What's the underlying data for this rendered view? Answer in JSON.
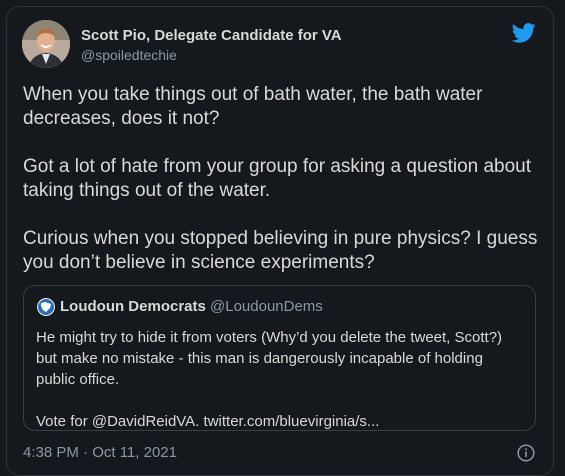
{
  "author": {
    "name": "Scott Pio, Delegate Candidate for VA",
    "handle": "@spoiledtechie"
  },
  "tweet": {
    "paragraphs": [
      "When you take things out of bath water, the bath water decreases, does it not?",
      "Got a lot of hate from your group for asking a question about taking things out of the water.",
      "Curious when you stopped believing in pure physics? I guess you don’t believe in science experiments?"
    ]
  },
  "quoted": {
    "name": "Loudoun Democrats",
    "handle": "@LoudounDems",
    "paragraphs": [
      "He might try to hide it from voters (Why’d you delete the tweet, Scott?) but make no mistake - this man is dangerously incapable of holding public office.",
      "Vote for @DavidReidVA. twitter.com/bluevirginia/s..."
    ]
  },
  "footer": {
    "timestamp": "4:38 PM · Oct 11, 2021"
  },
  "icons": {
    "brand": "twitter-bird-icon",
    "info": "info-icon"
  },
  "colors": {
    "background": "#15181c",
    "text": "#d9d9d9",
    "secondary_text": "#8b98a5",
    "twitter_blue": "#1d9bf0",
    "border": "#2f3336"
  }
}
